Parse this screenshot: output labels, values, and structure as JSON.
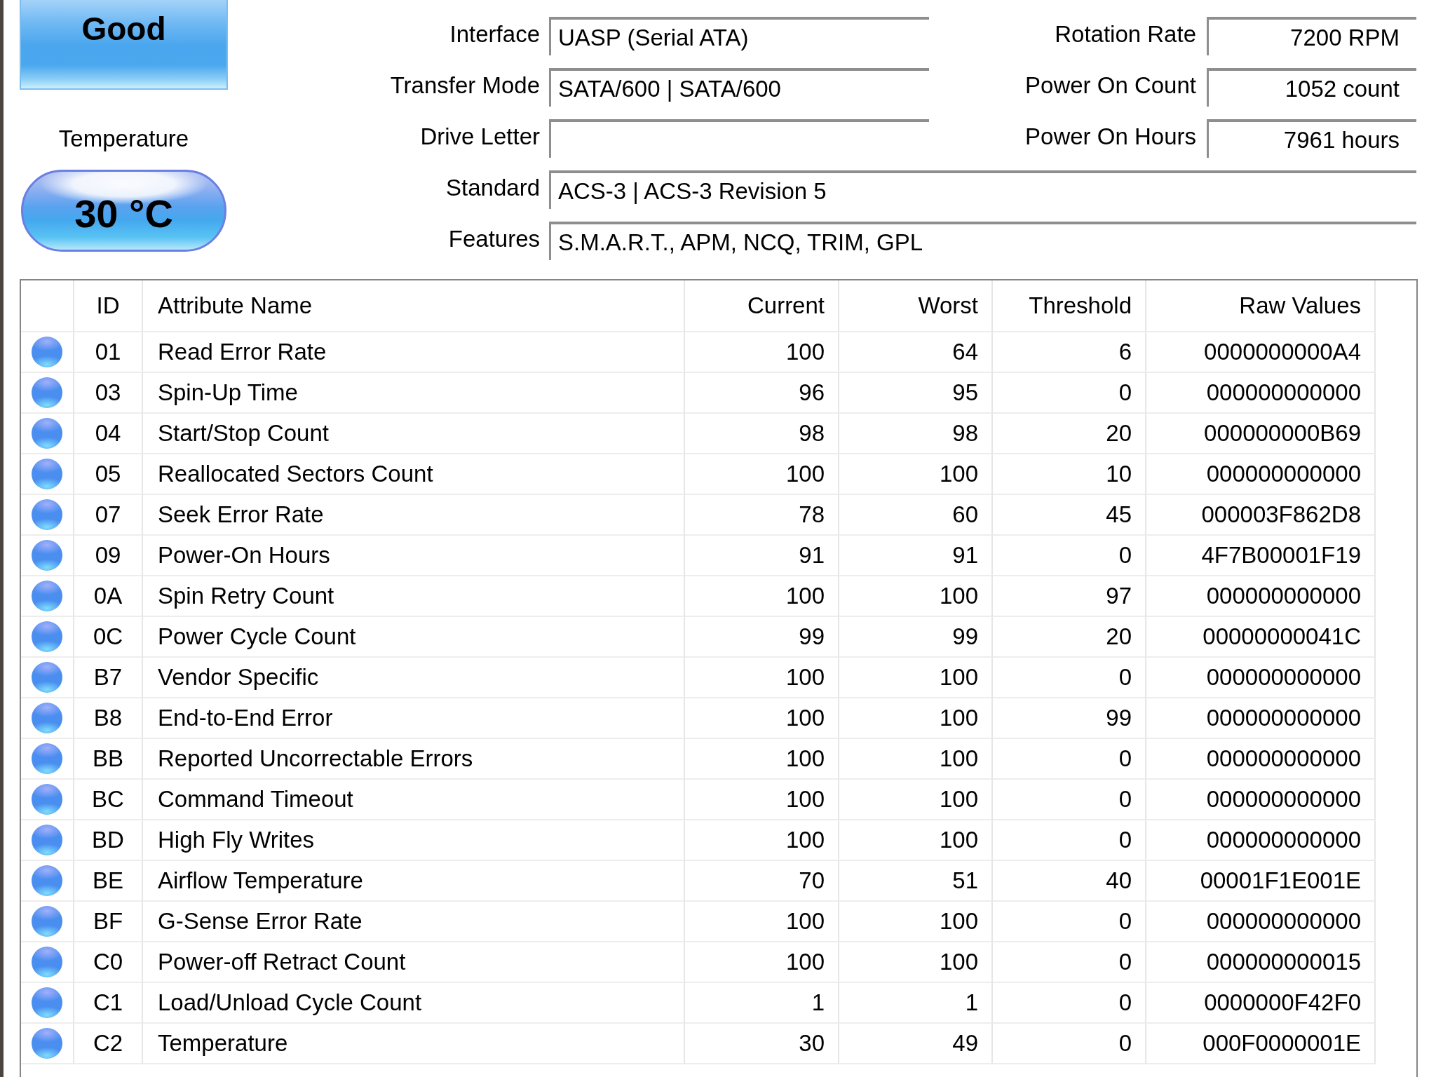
{
  "health": {
    "label": "Good"
  },
  "temperature": {
    "label": "Temperature",
    "value": "30 °C"
  },
  "info_rows": [
    {
      "label": "Interface",
      "value": "UASP (Serial ATA)",
      "side": {
        "label": "Rotation Rate",
        "value": "7200 RPM"
      }
    },
    {
      "label": "Transfer Mode",
      "value": "SATA/600 | SATA/600",
      "side": {
        "label": "Power On Count",
        "value": "1052 count"
      }
    },
    {
      "label": "Drive Letter",
      "side": {
        "label": "Power On Hours",
        "value": "7961 hours"
      }
    },
    {
      "label": "Standard",
      "value": "ACS-3 | ACS-3 Revision 5"
    },
    {
      "label": "Features",
      "value": "S.M.A.R.T., APM, NCQ, TRIM, GPL"
    }
  ],
  "smart_table": {
    "columns": [
      "ID",
      "Attribute Name",
      "Current",
      "Worst",
      "Threshold",
      "Raw Values"
    ],
    "rows": [
      {
        "color": "#4a8ef0",
        "id": "01",
        "name": "Read Error Rate",
        "current": "100",
        "worst": "64",
        "threshold": "6",
        "raw": "0000000000A4"
      },
      {
        "color": "#4a8ef0",
        "id": "03",
        "name": "Spin-Up Time",
        "current": "96",
        "worst": "95",
        "threshold": "0",
        "raw": "000000000000"
      },
      {
        "color": "#4a8ef0",
        "id": "04",
        "name": "Start/Stop Count",
        "current": "98",
        "worst": "98",
        "threshold": "20",
        "raw": "000000000B69"
      },
      {
        "color": "#4a8ef0",
        "id": "05",
        "name": "Reallocated Sectors Count",
        "current": "100",
        "worst": "100",
        "threshold": "10",
        "raw": "000000000000"
      },
      {
        "color": "#4a8ef0",
        "id": "07",
        "name": "Seek Error Rate",
        "current": "78",
        "worst": "60",
        "threshold": "45",
        "raw": "000003F862D8"
      },
      {
        "color": "#4a8ef0",
        "id": "09",
        "name": "Power-On Hours",
        "current": "91",
        "worst": "91",
        "threshold": "0",
        "raw": "4F7B00001F19"
      },
      {
        "color": "#4a8ef0",
        "id": "0A",
        "name": "Spin Retry Count",
        "current": "100",
        "worst": "100",
        "threshold": "97",
        "raw": "000000000000"
      },
      {
        "color": "#4a8ef0",
        "id": "0C",
        "name": "Power Cycle Count",
        "current": "99",
        "worst": "99",
        "threshold": "20",
        "raw": "00000000041C"
      },
      {
        "color": "#4a8ef0",
        "id": "B7",
        "name": "Vendor Specific",
        "current": "100",
        "worst": "100",
        "threshold": "0",
        "raw": "000000000000"
      },
      {
        "color": "#4a8ef0",
        "id": "B8",
        "name": "End-to-End Error",
        "current": "100",
        "worst": "100",
        "threshold": "99",
        "raw": "000000000000"
      },
      {
        "color": "#4a8ef0",
        "id": "BB",
        "name": "Reported Uncorrectable Errors",
        "current": "100",
        "worst": "100",
        "threshold": "0",
        "raw": "000000000000"
      },
      {
        "color": "#4a8ef0",
        "id": "BC",
        "name": "Command Timeout",
        "current": "100",
        "worst": "100",
        "threshold": "0",
        "raw": "000000000000"
      },
      {
        "color": "#4a8ef0",
        "id": "BD",
        "name": "High Fly Writes",
        "current": "100",
        "worst": "100",
        "threshold": "0",
        "raw": "000000000000"
      },
      {
        "color": "#4a8ef0",
        "id": "BE",
        "name": "Airflow Temperature",
        "current": "70",
        "worst": "51",
        "threshold": "40",
        "raw": "00001F1E001E"
      },
      {
        "color": "#4a8ef0",
        "id": "BF",
        "name": "G-Sense Error Rate",
        "current": "100",
        "worst": "100",
        "threshold": "0",
        "raw": "000000000000"
      },
      {
        "color": "#4a8ef0",
        "id": "C0",
        "name": "Power-off Retract Count",
        "current": "100",
        "worst": "100",
        "threshold": "0",
        "raw": "000000000015"
      },
      {
        "color": "#4a8ef0",
        "id": "C1",
        "name": "Load/Unload Cycle Count",
        "current": "1",
        "worst": "1",
        "threshold": "0",
        "raw": "0000000F42F0"
      },
      {
        "color": "#4a8ef0",
        "id": "C2",
        "name": "Temperature",
        "current": "30",
        "worst": "49",
        "threshold": "0",
        "raw": "000F0000001E"
      }
    ]
  }
}
